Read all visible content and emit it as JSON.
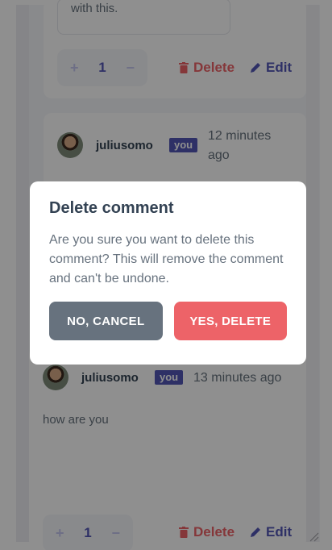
{
  "colors": {
    "primary": "#5357b6",
    "danger": "#ed6368",
    "text_dark": "#334253",
    "text_muted": "#67727e",
    "background": "#f5f6fa"
  },
  "top_comment": {
    "quoted_text": "with this.",
    "counter": {
      "plus": "+",
      "value": "1",
      "minus": "−"
    },
    "delete_label": "Delete",
    "edit_label": "Edit",
    "delete_icon": "trash-icon",
    "edit_icon": "pencil-icon"
  },
  "middle_comment": {
    "username": "juliusomo",
    "badge": "you",
    "timestamp": "12 minutes ago"
  },
  "bottom_comment": {
    "username": "juliusomo",
    "badge": "you",
    "timestamp": "13 minutes ago",
    "text": "how are you",
    "counter": {
      "plus": "+",
      "value": "1",
      "minus": "−"
    },
    "delete_label": "Delete",
    "edit_label": "Edit"
  },
  "modal": {
    "title": "Delete comment",
    "body": "Are you sure you want to delete this comment? This will remove the comment and can't be undone.",
    "cancel_label": "NO, CANCEL",
    "confirm_label": "YES, DELETE"
  }
}
